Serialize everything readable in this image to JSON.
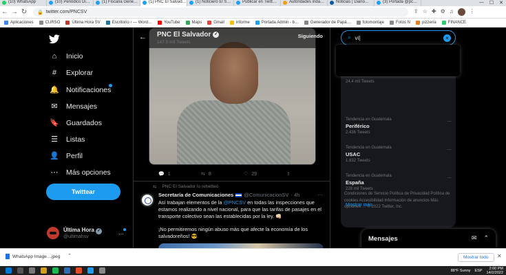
{
  "browser": {
    "tabs": [
      {
        "label": "(10) WhatsApp",
        "color": "#25d366",
        "active": false
      },
      {
        "label": "(10) Periódico Di…",
        "color": "#1da1f2",
        "active": false
      },
      {
        "label": "(1) Fiscalía Gene…",
        "color": "#1da1f2",
        "active": false
      },
      {
        "label": "(1) PNC El Salvad…",
        "color": "#1da1f2",
        "active": true
      },
      {
        "label": "(1) Noticiero El S…",
        "color": "#1da1f2",
        "active": false
      },
      {
        "label": "Publicar en Twitt…",
        "color": "#1da1f2",
        "active": false
      },
      {
        "label": "Autoridades inda…",
        "color": "#f59e0b",
        "active": false
      },
      {
        "label": "Noticias | Diario…",
        "color": "#0f5aa5",
        "active": false
      },
      {
        "label": "(3) Portada @pc…",
        "color": "#1da1f2",
        "active": false
      }
    ],
    "window_controls": [
      "—",
      "☐",
      "✕"
    ],
    "url": "twitter.com/PNCSV",
    "bookmarks": [
      {
        "label": "Aplicaciones",
        "color": "#4285f4"
      },
      {
        "label": "CURSO",
        "color": "#888"
      },
      {
        "label": "Última Hora SV",
        "color": "#c0392b"
      },
      {
        "label": "Escritorio ‹ — Word…",
        "color": "#21759b"
      },
      {
        "label": "YouTube",
        "color": "#ff0000"
      },
      {
        "label": "Maps",
        "color": "#34a853"
      },
      {
        "label": "Gmail",
        "color": "#ea4335"
      },
      {
        "label": "informe",
        "color": "#fbbc05"
      },
      {
        "label": "Portada Admin - b…",
        "color": "#1da1f2"
      },
      {
        "label": "Generador de Papá…",
        "color": "#888"
      },
      {
        "label": "fotomontaje",
        "color": "#888"
      },
      {
        "label": "Fotos N",
        "color": "#888"
      },
      {
        "label": "pizzeria",
        "color": "#e67e22"
      },
      {
        "label": "FINANCE",
        "color": "#2ecc71"
      }
    ]
  },
  "sidebar": {
    "logo": "twitter-bird",
    "items": [
      {
        "label": "Inicio",
        "icon": "⌂"
      },
      {
        "label": "Explorar",
        "icon": "#"
      },
      {
        "label": "Notificaciones",
        "icon": "🔔"
      },
      {
        "label": "Mensajes",
        "icon": "✉"
      },
      {
        "label": "Guardados",
        "icon": "🔖"
      },
      {
        "label": "Listas",
        "icon": "☰"
      },
      {
        "label": "Perfil",
        "icon": "👤"
      },
      {
        "label": "Más opciones",
        "icon": "⋯"
      }
    ],
    "tweet_button": "Twittear",
    "account": {
      "name": "Última Hora",
      "handle": "@ultimahsv"
    }
  },
  "main": {
    "header": {
      "name": "PNC El Salvador",
      "tweet_count": "147.5 mil Tweets",
      "follow_state": "Siguiendo"
    },
    "tweet1": {
      "replies": "1",
      "retweets": "8",
      "likes": "29"
    },
    "tweet2": {
      "retweeted_by": "PNC El Salvador lo retwitteó",
      "author": "Secretaría de Comunicaciones",
      "handle": "@ComunicacionSV",
      "time": "· 4h",
      "text_before": "Así trabajan elementos de la ",
      "mention": "@PNCSV",
      "text_after": " en todas las inspecciones que estamos realizando a nivel nacional, para que las tarifas de pasajes en el transporte colectivo sean las establecidas por la ley. 👊🏻",
      "text2": "¡No permitiremos ningún abuso más que afecte la economía de los salvadoreños! 😎"
    }
  },
  "right": {
    "search_value": "vi|",
    "trends": [
      {
        "category": "",
        "name": "",
        "count": "24,4 mil Tweets"
      },
      {
        "category": "Tendencia en Guatemala",
        "name": "Periférico",
        "count": "2.436 Tweets"
      },
      {
        "category": "Tendencia en Guatemala",
        "name": "USAC",
        "count": "1.832 Tweets"
      },
      {
        "category": "Tendencia en Guatemala",
        "name": "España",
        "count": "228 mil Tweets"
      }
    ],
    "show_more": "Mostrar más",
    "footer": "Condiciones de Servicio   Política de Privacidad   Política de cookies   Accesibilidad   Información de anuncios   Más opciones …   © 2022 Twitter, Inc.",
    "messages_title": "Mensajes"
  },
  "downloads": {
    "file": "WhatsApp Image....jpeg",
    "show_all": "Mostrar todo"
  },
  "taskbar": {
    "weather": "88°F  Sunny",
    "lang": "ESP",
    "time": "2:00 PM",
    "date": "14/2/2022"
  }
}
